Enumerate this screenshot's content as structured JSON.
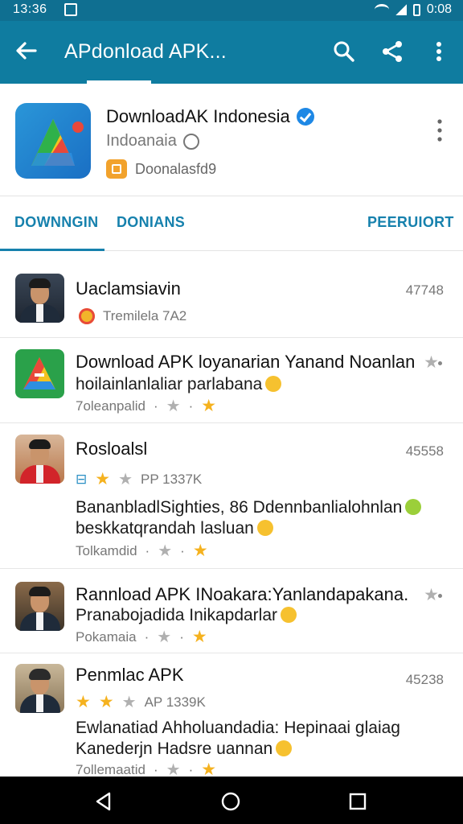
{
  "status_bar": {
    "time_left": "13:36",
    "time_right": "0:08"
  },
  "app_bar": {
    "title": "APdonload APK..."
  },
  "channel": {
    "name": "DownloadAK Indonesia",
    "country": "Indoanaia",
    "subtitle": "Doonalasfd9"
  },
  "tabs": [
    {
      "label": "DOWNNGIN"
    },
    {
      "label": "DONIANS"
    },
    {
      "label": "PEERUIORT"
    }
  ],
  "items": [
    {
      "title": "Uaclamsiavin",
      "count": "47748",
      "meta_text": "Tremilela 7A2"
    },
    {
      "title": "Download APK loyanarian Yanand Noanlan",
      "line2": "hoilainlanlaliar parlabana",
      "meta_text": "7oleanpalid"
    },
    {
      "title": "Rosloalsl",
      "count": "45558",
      "meta_text": "PP 1337K",
      "line1": "BananbladlSighties, 86 Ddennbanlialohnlan",
      "line2": "beskkatqrandah lasluan",
      "meta2_text": "Tolkamdid"
    },
    {
      "title": "Rannload APK INoakara:Yanlandapakana.",
      "line2": "Pranabojadida Inikapdarlar",
      "meta_text": "Pokamaia"
    },
    {
      "title": "Penmlac APK",
      "count": "45238",
      "meta_text": "AP 1339K",
      "line1": "Ewlanatiad Ahholuandadia: Hepinaai glaiag",
      "line2": "Kanederjn Hadsre uannan",
      "meta2_text": "7ollemaatid"
    }
  ],
  "colors": {
    "app_bar": "#0f7ca0",
    "status_bar": "#0f6f91",
    "accent": "#1681ad",
    "star": "#f5b21f",
    "badge": "#1e88e5"
  }
}
